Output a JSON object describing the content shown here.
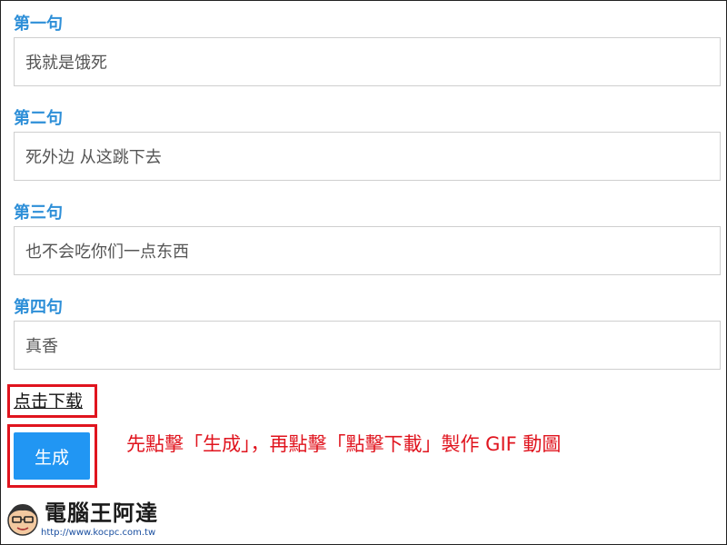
{
  "fields": [
    {
      "label": "第一句",
      "value": "我就是饿死"
    },
    {
      "label": "第二句",
      "value": "死外边 从这跳下去"
    },
    {
      "label": "第三句",
      "value": "也不会吃你们一点东西"
    },
    {
      "label": "第四句",
      "value": "真香"
    }
  ],
  "actions": {
    "download_link": "点击下载",
    "generate_button": "生成"
  },
  "annotation": "先點擊「生成」，再點擊「點擊下載」製作 GIF 動圖",
  "watermark": {
    "title": "電腦王阿達",
    "url": "http://www.kocpc.com.tw"
  },
  "colors": {
    "label_blue": "#2e8fd8",
    "button_blue": "#2196f3",
    "highlight_red": "#e0141e"
  }
}
